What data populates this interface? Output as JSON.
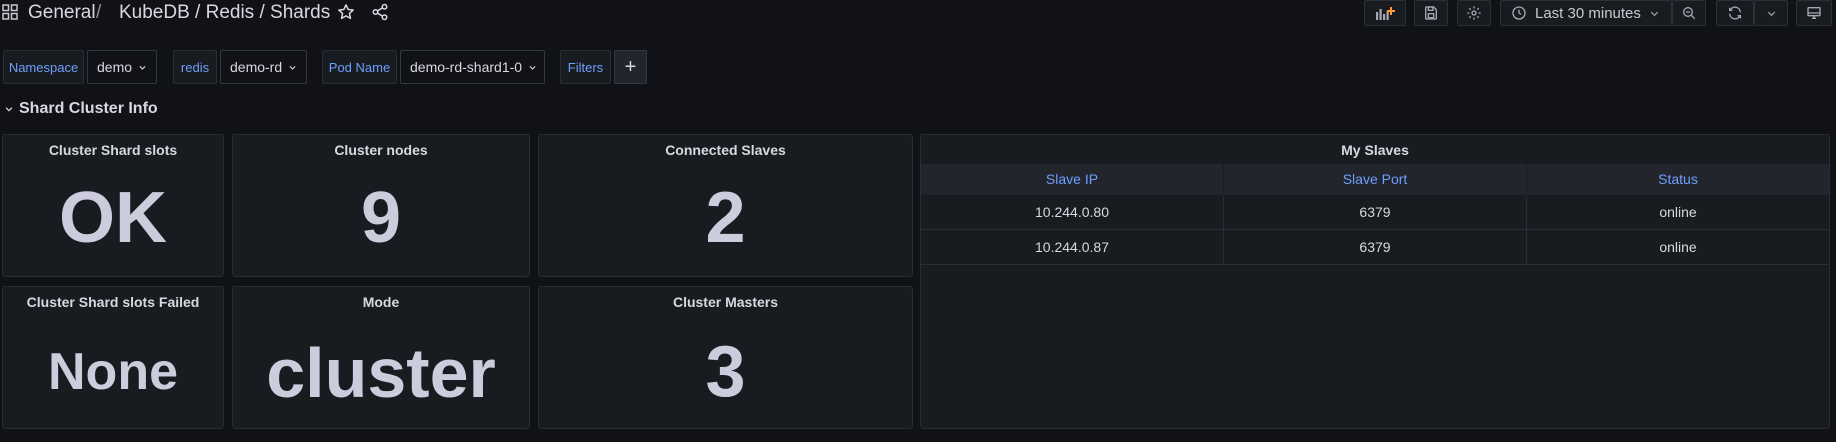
{
  "header": {
    "breadcrumb_root": "General",
    "separator": "/",
    "dashboard_path": "KubeDB / Redis / Shards",
    "time_range": "Last 30 minutes"
  },
  "icons": {
    "apps": "apps-grid-icon",
    "star": "star-icon",
    "share": "share-icon",
    "add_panel": "add-panel-icon",
    "save": "save-icon",
    "settings": "gear-icon",
    "clock": "clock-icon",
    "zoom_out": "zoom-out-icon",
    "refresh": "refresh-icon",
    "tv": "tv-monitor-icon"
  },
  "variables": [
    {
      "label": "Namespace",
      "value": "demo"
    },
    {
      "label": "redis",
      "value": "demo-rd"
    },
    {
      "label": "Pod Name",
      "value": "demo-rd-shard1-0"
    },
    {
      "label": "Filters",
      "value": "+"
    }
  ],
  "row": {
    "title": "Shard Cluster Info"
  },
  "panels": {
    "cluster_shard_slots": {
      "title": "Cluster Shard slots",
      "value": "OK"
    },
    "cluster_nodes": {
      "title": "Cluster nodes",
      "value": "9"
    },
    "connected_slaves": {
      "title": "Connected Slaves",
      "value": "2"
    },
    "cluster_shard_slots_failed": {
      "title": "Cluster Shard slots Failed",
      "value": "None"
    },
    "mode": {
      "title": "Mode",
      "value": "cluster"
    },
    "cluster_masters": {
      "title": "Cluster Masters",
      "value": "3"
    }
  },
  "my_slaves": {
    "title": "My Slaves",
    "columns": [
      "Slave IP",
      "Slave Port",
      "Status"
    ],
    "rows": [
      [
        "10.244.0.80",
        "6379",
        "online"
      ],
      [
        "10.244.0.87",
        "6379",
        "online"
      ]
    ]
  },
  "colors": {
    "background": "#111217",
    "panel": "#181b1f",
    "accent_blue": "#6e9fff",
    "text": "#ccccdc"
  }
}
